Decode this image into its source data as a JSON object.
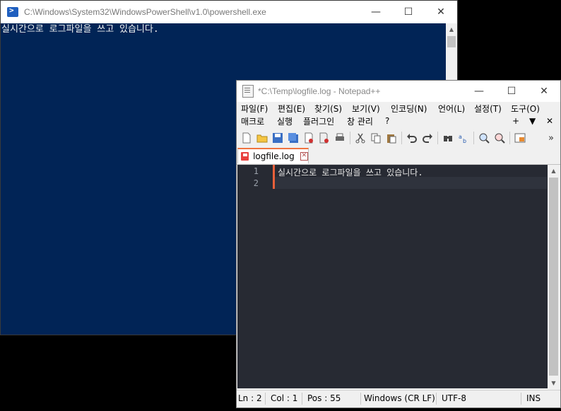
{
  "powershell": {
    "title": "C:\\Windows\\System32\\WindowsPowerShell\\v1.0\\powershell.exe",
    "console_text": "실시간으로 로그파일을 쓰고 있습니다.",
    "buttons": {
      "minimize": "—",
      "maximize": "☐",
      "close": "✕"
    }
  },
  "notepadpp": {
    "title": "*C:\\Temp\\logfile.log - Notepad++",
    "buttons": {
      "minimize": "—",
      "maximize": "☐",
      "close": "✕"
    },
    "menu_row1": [
      "파일(F)",
      "편집(E)",
      "찾기(S)",
      "보기(V)",
      "인코딩(N)",
      "언어(L)",
      "설정(T)",
      "도구(O)"
    ],
    "menu_row2": [
      "매크로",
      "실행",
      "플러그인",
      "창 관리",
      "?"
    ],
    "menu_right": {
      "plus": "+",
      "down": "▼",
      "close": "✕"
    },
    "toolbar_overflow": "»",
    "tab": {
      "name": "logfile.log",
      "close": "✕"
    },
    "lines": [
      {
        "number": "1",
        "text": "실시간으로 로그파일을 쓰고 있습니다."
      },
      {
        "number": "2",
        "text": ""
      }
    ],
    "status": {
      "ln": "Ln : 2",
      "col": "Col : 1",
      "pos": "Pos : 55",
      "eol": "Windows (CR LF)",
      "encoding": "UTF-8",
      "mode": "INS"
    }
  }
}
